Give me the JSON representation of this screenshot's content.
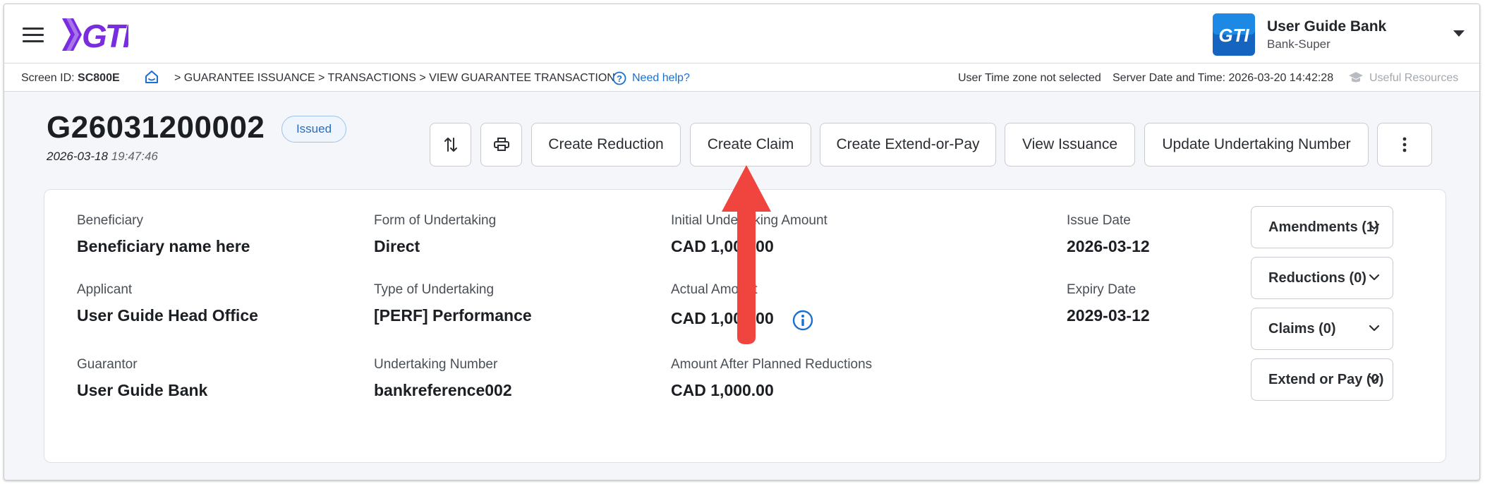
{
  "header": {
    "logo_text": "GTK",
    "bank_name": "User Guide Bank",
    "bank_role": "Bank-Super",
    "bank_logo_text": "GTI"
  },
  "subbar": {
    "screen_id_label": "Screen ID:",
    "screen_id_value": "SC800E",
    "breadcrumb": ">  GUARANTEE ISSUANCE > TRANSACTIONS > VIEW GUARANTEE TRANSACTION",
    "need_help": "Need help?",
    "timezone": "User Time zone not selected",
    "server_time": "Server Date and Time: 2026-03-20 14:42:28",
    "useful_resources": "Useful Resources"
  },
  "transaction": {
    "id": "G26031200002",
    "status": "Issued",
    "date": "2026-03-18",
    "time": "19:47:46"
  },
  "actions": {
    "create_reduction": "Create Reduction",
    "create_claim": "Create Claim",
    "create_extend_or_pay": "Create Extend-or-Pay",
    "view_issuance": "View Issuance",
    "update_undertaking_number": "Update Undertaking Number"
  },
  "details": {
    "beneficiary_label": "Beneficiary",
    "beneficiary_value": "Beneficiary name here",
    "applicant_label": "Applicant",
    "applicant_value": "User Guide Head Office",
    "guarantor_label": "Guarantor",
    "guarantor_value": "User Guide Bank",
    "form_label": "Form of Undertaking",
    "form_value": "Direct",
    "type_label": "Type of Undertaking",
    "type_value": "[PERF] Performance",
    "undertaking_number_label": "Undertaking Number",
    "undertaking_number_value": "bankreference002",
    "initial_amount_label": "Initial Undertaking Amount",
    "initial_amount_value": "CAD 1,000.00",
    "actual_amount_label": "Actual Amount",
    "actual_amount_value": "CAD 1,000.00",
    "planned_amount_label": "Amount After Planned Reductions",
    "planned_amount_value": "CAD 1,000.00",
    "issue_date_label": "Issue Date",
    "issue_date_value": "2026-03-12",
    "expiry_date_label": "Expiry Date",
    "expiry_date_value": "2029-03-12"
  },
  "accordions": {
    "amendments": "Amendments (1)",
    "reductions": "Reductions (0)",
    "claims": "Claims (0)",
    "extend_or_pay": "Extend or Pay (0)"
  },
  "colors": {
    "accent_blue": "#1a6fd1",
    "logo_purple": "#7a2de0",
    "annotation_red": "#f0453f",
    "badge_border": "#9fc3ea"
  },
  "icons": {
    "menu": "hamburger-icon",
    "home": "home-icon",
    "help": "help-circle-icon",
    "resources": "graduation-cap-icon",
    "sort": "sort-arrows-icon",
    "print": "printer-icon",
    "more": "more-vertical-icon",
    "info": "info-icon",
    "chevron": "chevron-down-icon"
  }
}
